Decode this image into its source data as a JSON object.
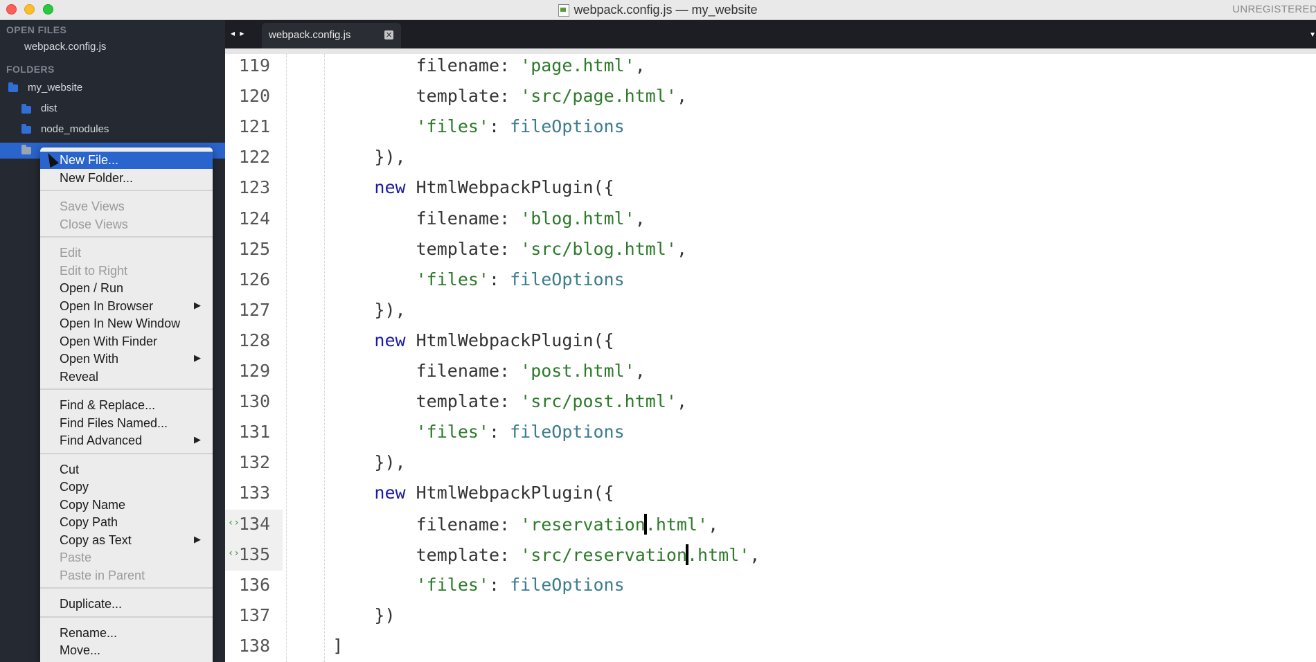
{
  "window": {
    "title": "webpack.config.js — my_website",
    "registration": "UNREGISTERED"
  },
  "sidebar": {
    "open_files_heading": "OPEN FILES",
    "open_files": [
      "webpack.config.js"
    ],
    "folders_heading": "FOLDERS",
    "root_folder": "my_website",
    "folders": [
      "dist",
      "node_modules"
    ]
  },
  "tabs": {
    "active": "webpack.config.js",
    "close_glyph": "×",
    "nav_glyph": "◂ ▸",
    "dropdown_glyph": "▼"
  },
  "editor": {
    "modified_marker": "‹›",
    "lines": [
      {
        "n": "119",
        "t": [
          [
            "            ",
            "p"
          ],
          [
            "filename",
            "key"
          ],
          [
            ": ",
            "p"
          ],
          [
            "'page.html'",
            "str"
          ],
          [
            ",",
            "p"
          ]
        ]
      },
      {
        "n": "120",
        "t": [
          [
            "            ",
            "p"
          ],
          [
            "template",
            "key"
          ],
          [
            ": ",
            "p"
          ],
          [
            "'src/page.html'",
            "str"
          ],
          [
            ",",
            "p"
          ]
        ]
      },
      {
        "n": "121",
        "t": [
          [
            "            ",
            "p"
          ],
          [
            "'files'",
            "str"
          ],
          [
            ": ",
            "p"
          ],
          [
            "fileOptions",
            "id"
          ]
        ]
      },
      {
        "n": "122",
        "t": [
          [
            "        ",
            "p"
          ],
          [
            "}),",
            "p"
          ]
        ]
      },
      {
        "n": "123",
        "t": [
          [
            "        ",
            "p"
          ],
          [
            "new",
            "kw"
          ],
          [
            " HtmlWebpackPlugin({",
            "p"
          ]
        ]
      },
      {
        "n": "124",
        "t": [
          [
            "            ",
            "p"
          ],
          [
            "filename",
            "key"
          ],
          [
            ": ",
            "p"
          ],
          [
            "'blog.html'",
            "str"
          ],
          [
            ",",
            "p"
          ]
        ]
      },
      {
        "n": "125",
        "t": [
          [
            "            ",
            "p"
          ],
          [
            "template",
            "key"
          ],
          [
            ": ",
            "p"
          ],
          [
            "'src/blog.html'",
            "str"
          ],
          [
            ",",
            "p"
          ]
        ]
      },
      {
        "n": "126",
        "t": [
          [
            "            ",
            "p"
          ],
          [
            "'files'",
            "str"
          ],
          [
            ": ",
            "p"
          ],
          [
            "fileOptions",
            "id"
          ]
        ]
      },
      {
        "n": "127",
        "t": [
          [
            "        ",
            "p"
          ],
          [
            "}),",
            "p"
          ]
        ]
      },
      {
        "n": "128",
        "t": [
          [
            "        ",
            "p"
          ],
          [
            "new",
            "kw"
          ],
          [
            " HtmlWebpackPlugin({",
            "p"
          ]
        ]
      },
      {
        "n": "129",
        "t": [
          [
            "            ",
            "p"
          ],
          [
            "filename",
            "key"
          ],
          [
            ": ",
            "p"
          ],
          [
            "'post.html'",
            "str"
          ],
          [
            ",",
            "p"
          ]
        ]
      },
      {
        "n": "130",
        "t": [
          [
            "            ",
            "p"
          ],
          [
            "template",
            "key"
          ],
          [
            ": ",
            "p"
          ],
          [
            "'src/post.html'",
            "str"
          ],
          [
            ",",
            "p"
          ]
        ]
      },
      {
        "n": "131",
        "t": [
          [
            "            ",
            "p"
          ],
          [
            "'files'",
            "str"
          ],
          [
            ": ",
            "p"
          ],
          [
            "fileOptions",
            "id"
          ]
        ]
      },
      {
        "n": "132",
        "t": [
          [
            "        ",
            "p"
          ],
          [
            "}),",
            "p"
          ]
        ]
      },
      {
        "n": "133",
        "t": [
          [
            "        ",
            "p"
          ],
          [
            "new",
            "kw"
          ],
          [
            " HtmlWebpackPlugin({",
            "p"
          ]
        ]
      },
      {
        "n": "134",
        "mod": true,
        "t": [
          [
            "            ",
            "p"
          ],
          [
            "filename",
            "key"
          ],
          [
            ": ",
            "p"
          ],
          [
            "'reservation",
            "str"
          ],
          [
            "|",
            "caret"
          ],
          [
            ".html'",
            "str"
          ],
          [
            ",",
            "p"
          ]
        ]
      },
      {
        "n": "135",
        "mod": true,
        "t": [
          [
            "            ",
            "p"
          ],
          [
            "template",
            "key"
          ],
          [
            ": ",
            "p"
          ],
          [
            "'src/reservation",
            "str"
          ],
          [
            "|",
            "caret"
          ],
          [
            ".html'",
            "str"
          ],
          [
            ",",
            "p"
          ]
        ]
      },
      {
        "n": "136",
        "t": [
          [
            "            ",
            "p"
          ],
          [
            "'files'",
            "str"
          ],
          [
            ": ",
            "p"
          ],
          [
            "fileOptions",
            "id"
          ]
        ]
      },
      {
        "n": "137",
        "t": [
          [
            "        ",
            "p"
          ],
          [
            "})",
            "p"
          ]
        ]
      },
      {
        "n": "138",
        "t": [
          [
            "    ",
            "p"
          ],
          [
            "]",
            "p"
          ]
        ]
      }
    ]
  },
  "context_menu": {
    "items": [
      {
        "label": "New File...",
        "state": "highlighted"
      },
      {
        "label": "New Folder...",
        "state": "enabled"
      },
      {
        "sep": true
      },
      {
        "label": "Save Views",
        "state": "disabled"
      },
      {
        "label": "Close Views",
        "state": "disabled"
      },
      {
        "sep": true
      },
      {
        "label": "Edit",
        "state": "disabled"
      },
      {
        "label": "Edit to Right",
        "state": "disabled"
      },
      {
        "label": "Open / Run",
        "state": "enabled"
      },
      {
        "label": "Open In Browser",
        "state": "enabled",
        "submenu": true
      },
      {
        "label": "Open In New Window",
        "state": "enabled"
      },
      {
        "label": "Open With Finder",
        "state": "enabled"
      },
      {
        "label": "Open With",
        "state": "enabled",
        "submenu": true
      },
      {
        "label": "Reveal",
        "state": "enabled"
      },
      {
        "sep": true
      },
      {
        "label": "Find & Replace...",
        "state": "enabled"
      },
      {
        "label": "Find Files Named...",
        "state": "enabled"
      },
      {
        "label": "Find Advanced",
        "state": "enabled",
        "submenu": true
      },
      {
        "sep": true
      },
      {
        "label": "Cut",
        "state": "enabled"
      },
      {
        "label": "Copy",
        "state": "enabled"
      },
      {
        "label": "Copy Name",
        "state": "enabled"
      },
      {
        "label": "Copy Path",
        "state": "enabled"
      },
      {
        "label": "Copy as Text",
        "state": "enabled",
        "submenu": true
      },
      {
        "label": "Paste",
        "state": "disabled"
      },
      {
        "label": "Paste in Parent",
        "state": "disabled"
      },
      {
        "sep": true
      },
      {
        "label": "Duplicate...",
        "state": "enabled"
      },
      {
        "sep": true
      },
      {
        "label": "Rename...",
        "state": "enabled"
      },
      {
        "label": "Move...",
        "state": "enabled"
      }
    ],
    "submenu_glyph": "▶"
  }
}
